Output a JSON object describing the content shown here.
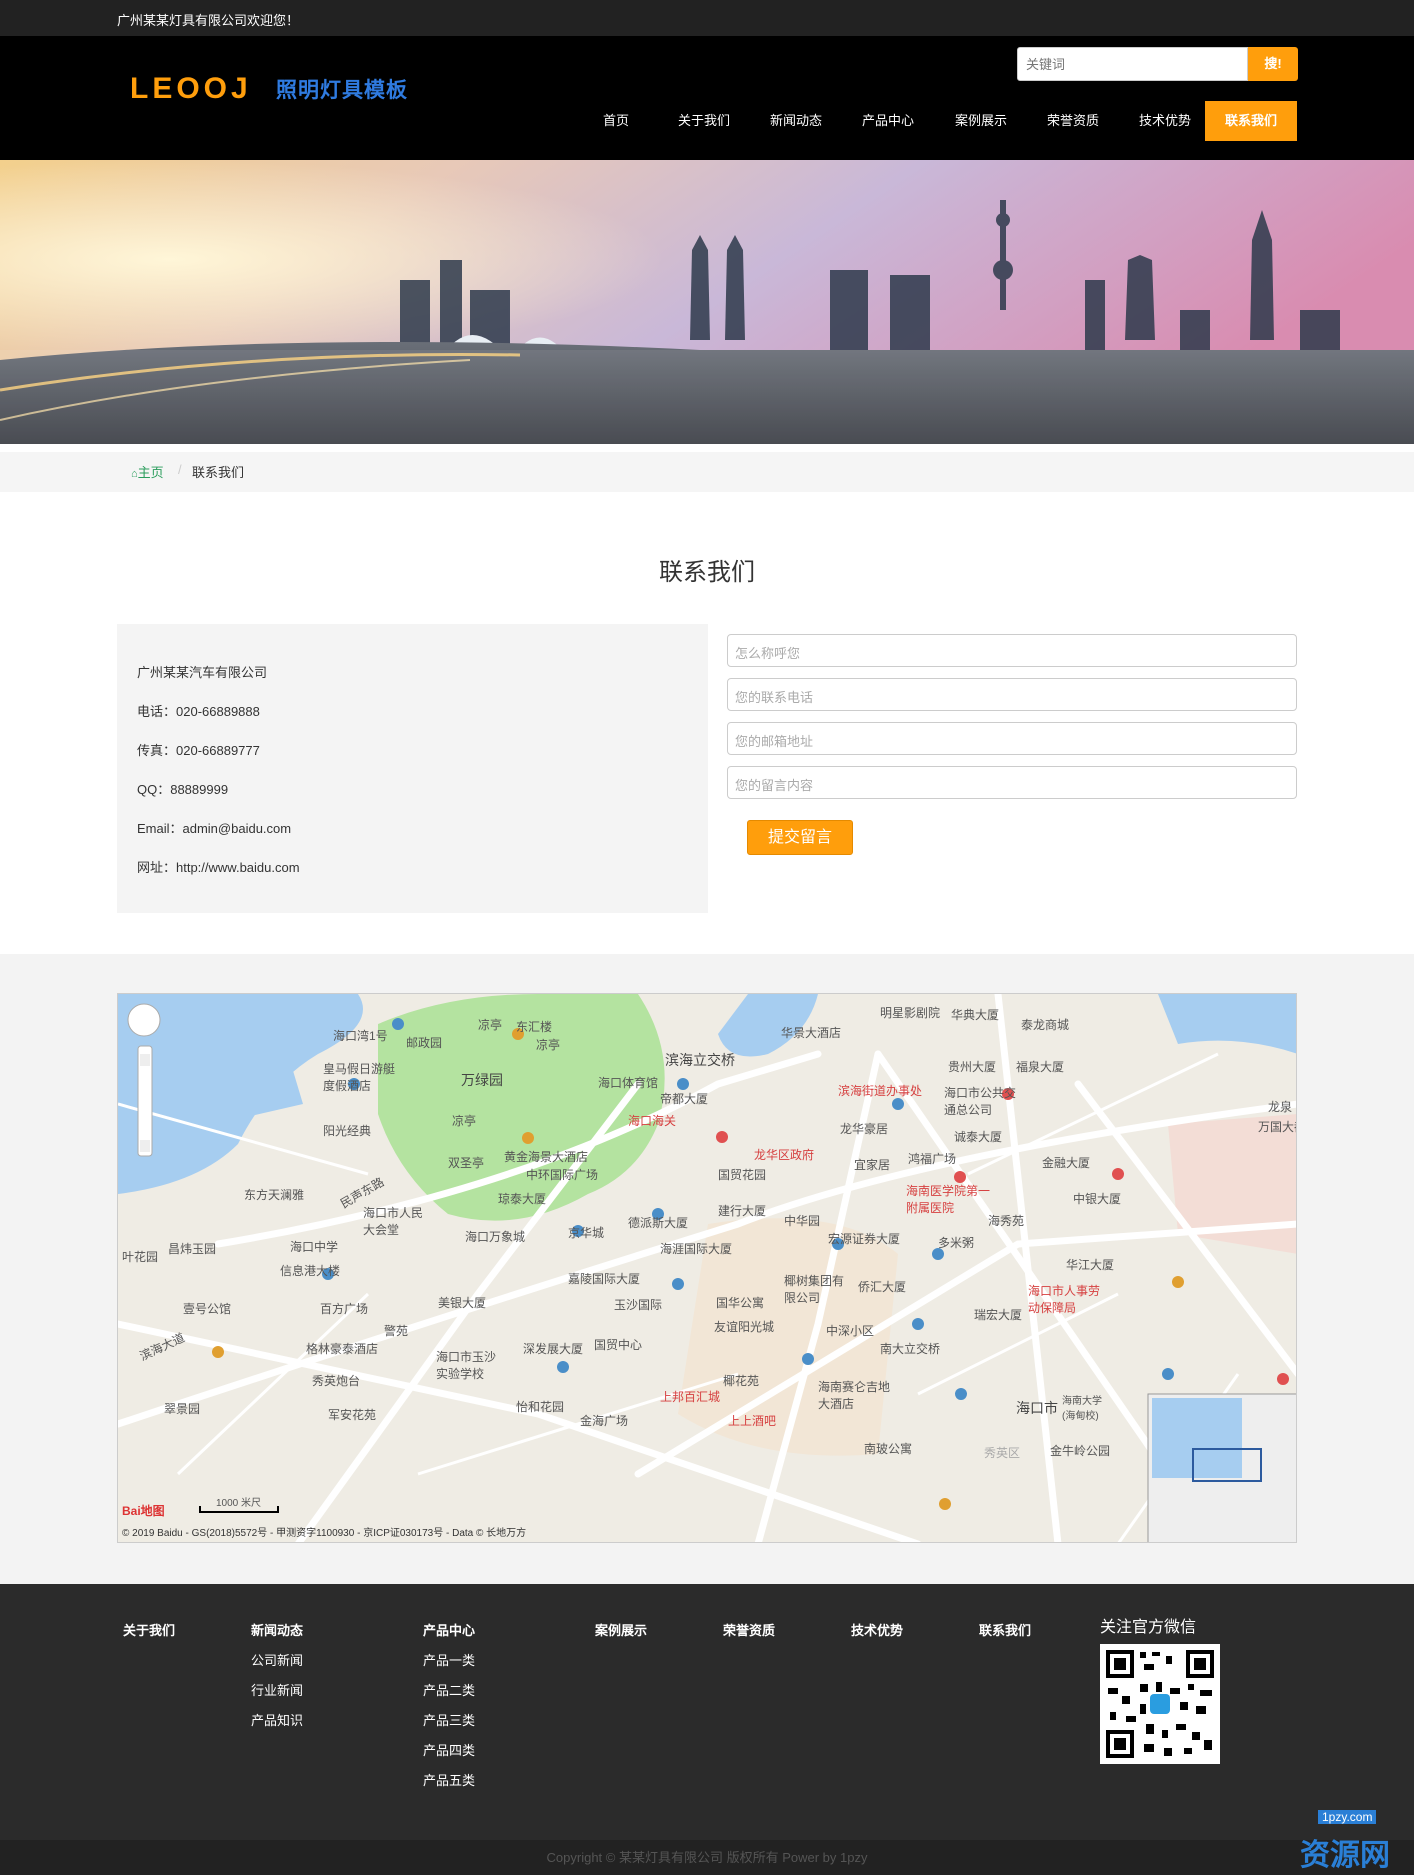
{
  "topbar": {
    "welcome": "广州某某灯具有限公司欢迎您！"
  },
  "header": {
    "logo_text": "LEOOJ",
    "logo_sub": "照明灯具模板",
    "search_placeholder": "关键词",
    "search_button": "搜!",
    "nav": [
      "首页",
      "关于我们",
      "新闻动态",
      "产品中心",
      "案例展示",
      "荣誉资质",
      "技术优势",
      "联系我们"
    ],
    "nav_active": "联系我们"
  },
  "colors": {
    "accent": "#ff9e0c",
    "header_bg": "#000000",
    "footer_bg": "#2b2b2b",
    "home_link": "#2a9d5c"
  },
  "breadcrumb": {
    "home": "主页",
    "current": "联系我们"
  },
  "page_title": "联系我们",
  "contact": {
    "company": "广州某某汽车有限公司",
    "phone": "电话：020-66889888",
    "fax": "传真：020-66889777",
    "qq": "QQ：88889999",
    "email": "Email：admin@baidu.com",
    "website": "网址：http://www.baidu.com"
  },
  "form": {
    "name_placeholder": "怎么称呼您",
    "phone_placeholder": "您的联系电话",
    "email_placeholder": "您的邮箱地址",
    "message_placeholder": "您的留言内容",
    "submit": "提交留言"
  },
  "map": {
    "labels": [
      "海口湾1号",
      "邮政园",
      "凉亭",
      "东汇楼",
      "凉亭",
      "万绿园",
      "海口体育馆",
      "滨海立交桥",
      "华景大酒店",
      "明星影剧院",
      "华典大厦",
      "泰龙商城",
      "皇马假日游艇度假酒店",
      "帝都大厦",
      "贵州大厦",
      "福泉大厦",
      "滨海街道办事处",
      "海口市公共交通总公司",
      "龙泉",
      "凉亭",
      "海口海关",
      "龙华豪居",
      "诚泰大厦",
      "万国大都会",
      "阳光经典",
      "黄金海景大酒店",
      "龙华区政府",
      "宜家居",
      "鸿福广场",
      "金融大厦",
      "双圣亭",
      "中环国际广场",
      "国贸花园",
      "海南医学院第一附属医院",
      "中银大厦",
      "东方天澜雅",
      "民声东路",
      "琼泰大厦",
      "建行大厦",
      "海口市人民大会堂",
      "中华园",
      "海秀苑",
      "德派斯大厦",
      "京华城",
      "多米粥",
      "海口万象城",
      "海口中学",
      "海涯国际大厦",
      "宏源证券大厦",
      "昌炜玉园",
      "叶花园",
      "信息港大楼",
      "华江大厦",
      "嘉陵国际大厦",
      "椰树集团有限公司",
      "侨汇大厦",
      "海口市人事劳动保障局",
      "壹号公馆",
      "百方广场",
      "美银大厦",
      "玉沙国际",
      "国华公寓",
      "瑞宏大厦",
      "警苑",
      "友谊阳光城",
      "中深小区",
      "滨海大道",
      "海口市玉沙实验学校",
      "国贸中心",
      "南大立交桥",
      "格林豪泰酒店",
      "深发展大厦",
      "椰花苑",
      "秀英炮台",
      "上邦百汇城",
      "海南赛仑吉地大酒店",
      "翠景园",
      "怡和花园",
      "军安花苑",
      "金海广场",
      "上上酒吧",
      "南玻公寓",
      "海口市",
      "秀英区",
      "金牛岭公园",
      "海南大学(海甸校)"
    ],
    "scale": "1000 米尺",
    "copyright": "© 2019 Baidu - GS(2018)5572号 - 甲测资字1100930 - 京ICP证030173号 - Data © 长地万方",
    "logo": "Bai地图"
  },
  "footer": {
    "columns": [
      {
        "title": "关于我们",
        "items": []
      },
      {
        "title": "新闻动态",
        "items": [
          "公司新闻",
          "行业新闻",
          "产品知识"
        ]
      },
      {
        "title": "产品中心",
        "items": [
          "产品一类",
          "产品二类",
          "产品三类",
          "产品四类",
          "产品五类"
        ]
      },
      {
        "title": "案例展示",
        "items": []
      },
      {
        "title": "荣誉资质",
        "items": []
      },
      {
        "title": "技术优势",
        "items": []
      },
      {
        "title": "联系我们",
        "items": []
      }
    ],
    "wechat_title": "关注官方微信",
    "copyright": "Copyright © 某某灯具有限公司 版权所有 Power by 1pzy",
    "watermark_domain": "1pzy.com",
    "watermark_text": "资源网"
  }
}
